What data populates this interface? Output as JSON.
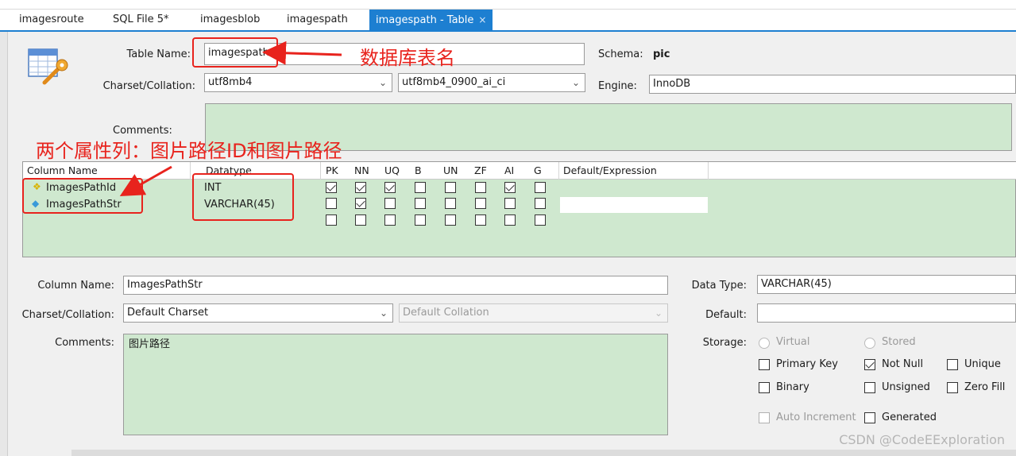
{
  "tabs": [
    {
      "label": "imagesroute"
    },
    {
      "label": "SQL File 5*"
    },
    {
      "label": "imagesblob"
    },
    {
      "label": "imagespath"
    },
    {
      "label": "imagespath - Table",
      "close": "×"
    }
  ],
  "table_editor": {
    "table_name_label": "Table Name:",
    "table_name_value": "imagespath",
    "schema_label": "Schema:",
    "schema_value": "pic",
    "charset_label": "Charset/Collation:",
    "charset_value": "utf8mb4",
    "collation_value": "utf8mb4_0900_ai_ci",
    "engine_label": "Engine:",
    "engine_value": "InnoDB",
    "comments_label": "Comments:",
    "comments_value": ""
  },
  "columns_grid": {
    "headers": [
      "Column Name",
      "Datatype",
      "PK",
      "NN",
      "UQ",
      "B",
      "UN",
      "ZF",
      "AI",
      "G",
      "Default/Expression"
    ],
    "rows": [
      {
        "name": "ImagesPathId",
        "key_icon": "primary-key-icon",
        "datatype": "INT",
        "flags": {
          "PK": true,
          "NN": true,
          "UQ": true,
          "B": false,
          "UN": false,
          "ZF": false,
          "AI": true,
          "G": false
        }
      },
      {
        "name": "ImagesPathStr",
        "key_icon": "column-diamond-icon",
        "datatype": "VARCHAR(45)",
        "flags": {
          "PK": false,
          "NN": true,
          "UQ": false,
          "B": false,
          "UN": false,
          "ZF": false,
          "AI": false,
          "G": false
        }
      }
    ]
  },
  "column_details": {
    "column_name_label": "Column Name:",
    "column_name_value": "ImagesPathStr",
    "charset_label": "Charset/Collation:",
    "charset_value": "Default Charset",
    "collation_value": "Default Collation",
    "comments_label": "Comments:",
    "comments_value": "图片路径",
    "data_type_label": "Data Type:",
    "data_type_value": "VARCHAR(45)",
    "default_label": "Default:",
    "default_value": "",
    "storage_label": "Storage:",
    "virtual_label": "Virtual",
    "stored_label": "Stored",
    "primary_key_label": "Primary Key",
    "not_null_label": "Not Null",
    "unique_label": "Unique",
    "binary_label": "Binary",
    "unsigned_label": "Unsigned",
    "zero_fill_label": "Zero Fill",
    "auto_increment_label": "Auto Increment",
    "generated_label": "Generated",
    "not_null_checked": true
  },
  "annotations": {
    "table_name_note": "数据库表名",
    "columns_note": "两个属性列：图片路径ID和图片路径",
    "color": "#e8231d"
  },
  "watermark": "CSDN @CodeEExploration",
  "colors": {
    "accent": "#1d7fd1",
    "grid_green": "#cfe8cf"
  }
}
